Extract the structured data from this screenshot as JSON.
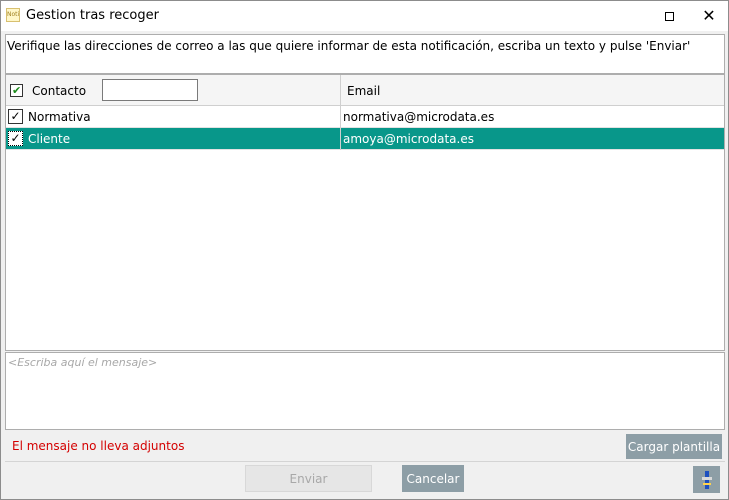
{
  "window": {
    "title": "Gestion tras recoger",
    "icon": "app-notification-icon"
  },
  "instruction": "Verifique las direcciones de correo a las que quiere informar de esta notificación, escriba un texto y pulse 'Enviar'",
  "grid": {
    "header": {
      "contacto_label": "Contacto",
      "email_label": "Email",
      "filter_value": "",
      "all_checked": true
    },
    "rows": [
      {
        "name": "Normativa",
        "email": "normativa@microdata.es",
        "checked": true,
        "selected": false
      },
      {
        "name": "Cliente",
        "email": "amoya@microdata.es",
        "checked": true,
        "selected": true
      }
    ]
  },
  "message": {
    "value": "",
    "placeholder": "<Escriba aquí el mensaje>"
  },
  "attachments_note": "El mensaje no lleva adjuntos",
  "buttons": {
    "cargar_plantilla": "Cargar plantilla",
    "enviar": "Enviar",
    "cancelar": "Cancelar",
    "tool_icon": "settings-tool-icon"
  },
  "colors": {
    "selected_row": "#08978a",
    "button": "#8d9ea6",
    "warning_text": "#d40000"
  }
}
